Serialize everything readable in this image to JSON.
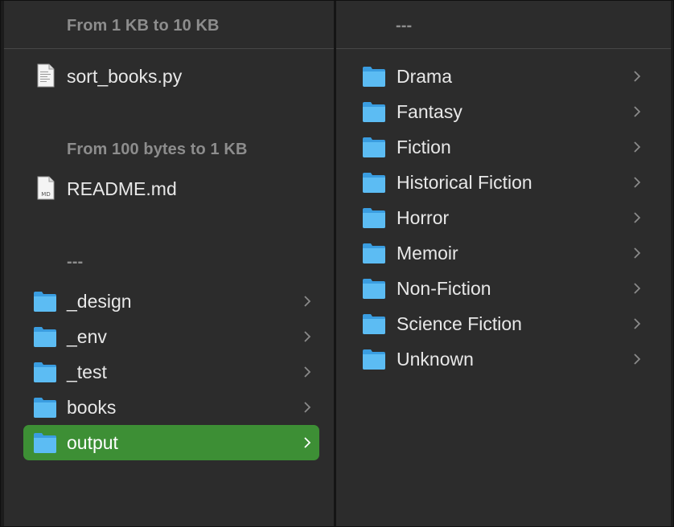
{
  "left_column": {
    "groups": [
      {
        "heading": "From 1 KB to 10 KB",
        "items": [
          {
            "name": "sort_books.py",
            "icon": "python-file-icon",
            "kind": "file"
          }
        ]
      },
      {
        "heading": "From 100 bytes to 1 KB",
        "items": [
          {
            "name": "README.md",
            "icon": "markdown-file-icon",
            "kind": "file",
            "badge": "MD"
          }
        ]
      },
      {
        "heading": "---",
        "items": [
          {
            "name": "_design",
            "icon": "folder-icon",
            "kind": "folder"
          },
          {
            "name": "_env",
            "icon": "folder-icon",
            "kind": "folder"
          },
          {
            "name": "_test",
            "icon": "folder-icon",
            "kind": "folder"
          },
          {
            "name": "books",
            "icon": "folder-icon",
            "kind": "folder"
          },
          {
            "name": "output",
            "icon": "folder-icon",
            "kind": "folder",
            "selected": true
          }
        ]
      }
    ]
  },
  "right_column": {
    "heading": "---",
    "items": [
      {
        "name": "Drama",
        "icon": "folder-icon"
      },
      {
        "name": "Fantasy",
        "icon": "folder-icon"
      },
      {
        "name": "Fiction",
        "icon": "folder-icon"
      },
      {
        "name": "Historical Fiction",
        "icon": "folder-icon"
      },
      {
        "name": "Horror",
        "icon": "folder-icon"
      },
      {
        "name": "Memoir",
        "icon": "folder-icon"
      },
      {
        "name": "Non-Fiction",
        "icon": "folder-icon"
      },
      {
        "name": "Science Fiction",
        "icon": "folder-icon"
      },
      {
        "name": "Unknown",
        "icon": "folder-icon"
      }
    ]
  },
  "colors": {
    "selection": "#3d8f35",
    "folder": "#4fb3ef",
    "heading": "#8d8d8d"
  }
}
